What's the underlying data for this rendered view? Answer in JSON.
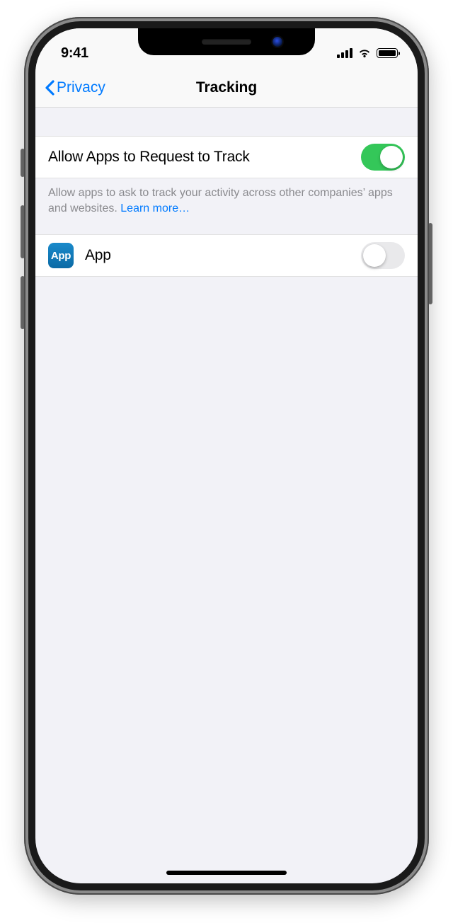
{
  "status": {
    "time": "9:41"
  },
  "nav": {
    "back_label": "Privacy",
    "title": "Tracking"
  },
  "settings": {
    "allow_request": {
      "label": "Allow Apps to Request to Track",
      "on": true
    },
    "footer_text": "Allow apps to ask to track your activity across other companies’ apps and websites. ",
    "learn_more_label": "Learn more…"
  },
  "apps": [
    {
      "icon_text": "App",
      "name": "App",
      "on": false
    }
  ]
}
